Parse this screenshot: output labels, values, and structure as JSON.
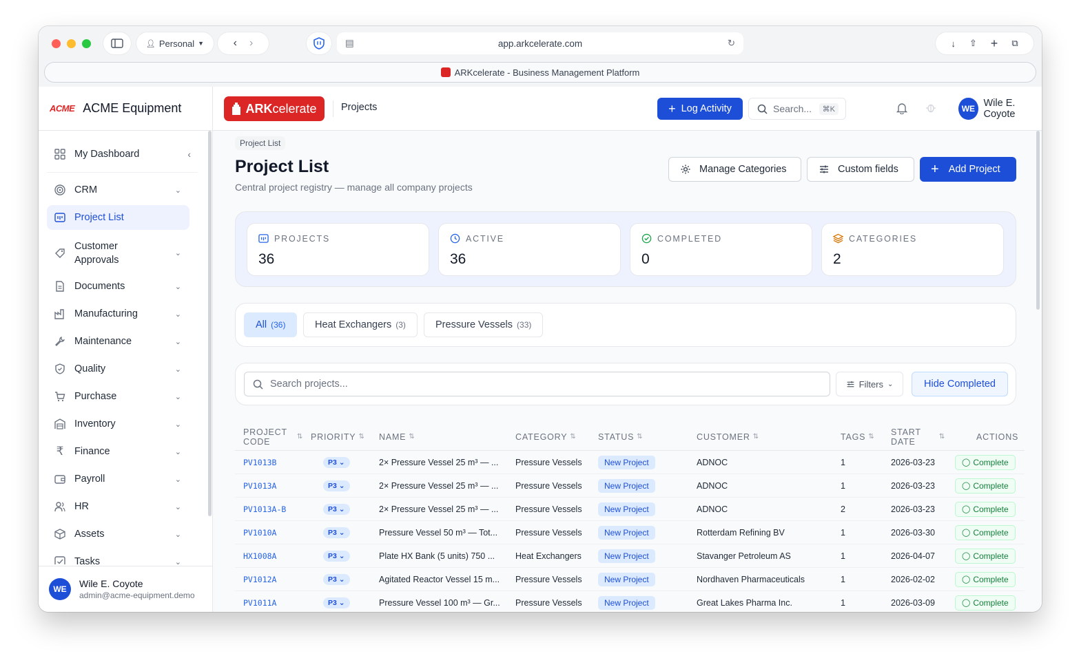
{
  "browser": {
    "profile": "Personal",
    "url": "app.arkcelerate.com",
    "tab_title": "ARKcelerate - Business Management Platform"
  },
  "sidebar": {
    "org_logo": "ACME",
    "org_name": "ACME Equipment",
    "items": [
      {
        "label": "My Dashboard",
        "icon": "dashboard-icon"
      },
      {
        "label": "CRM",
        "icon": "target-icon"
      },
      {
        "label": "Project List",
        "icon": "project-icon"
      },
      {
        "label": "Customer Approvals",
        "icon": "tag-icon"
      },
      {
        "label": "Documents",
        "icon": "document-icon"
      },
      {
        "label": "Manufacturing",
        "icon": "factory-icon"
      },
      {
        "label": "Maintenance",
        "icon": "wrench-icon"
      },
      {
        "label": "Quality",
        "icon": "shield-icon"
      },
      {
        "label": "Purchase",
        "icon": "cart-icon"
      },
      {
        "label": "Inventory",
        "icon": "warehouse-icon"
      },
      {
        "label": "Finance",
        "icon": "rupee-icon"
      },
      {
        "label": "Payroll",
        "icon": "wallet-icon"
      },
      {
        "label": "HR",
        "icon": "users-icon"
      },
      {
        "label": "Assets",
        "icon": "box-icon"
      },
      {
        "label": "Tasks",
        "icon": "checkbox-icon"
      }
    ],
    "user": {
      "initials": "WE",
      "name": "Wile E. Coyote",
      "email": "admin@acme-equipment.demo"
    }
  },
  "topbar": {
    "brand_bold": "ARK",
    "brand_light": "celerate",
    "title": "Projects",
    "log_activity": "Log Activity",
    "search_placeholder": "Search...",
    "search_kbd": "⌘K",
    "user_initials": "WE",
    "user_name": "Wile E. Coyote"
  },
  "page": {
    "breadcrumb": "Project List",
    "title": "Project List",
    "subtitle": "Central project registry — manage all company projects",
    "manage_categories": "Manage Categories",
    "custom_fields": "Custom fields",
    "add_project": "Add Project"
  },
  "stats": [
    {
      "label": "PROJECTS",
      "value": "36"
    },
    {
      "label": "ACTIVE",
      "value": "36"
    },
    {
      "label": "COMPLETED",
      "value": "0"
    },
    {
      "label": "CATEGORIES",
      "value": "2"
    }
  ],
  "category_tabs": [
    {
      "label": "All",
      "count": "(36)"
    },
    {
      "label": "Heat Exchangers",
      "count": "(3)"
    },
    {
      "label": "Pressure Vessels",
      "count": "(33)"
    }
  ],
  "filters": {
    "search_placeholder": "Search projects...",
    "filters_label": "Filters",
    "hide_completed": "Hide Completed"
  },
  "table": {
    "headers": {
      "code1": "PROJECT",
      "code2": "CODE",
      "priority": "PRIORITY",
      "name": "NAME",
      "category": "CATEGORY",
      "status": "STATUS",
      "customer": "CUSTOMER",
      "tags": "TAGS",
      "start1": "START",
      "start2": "DATE",
      "actions": "ACTIONS"
    },
    "rows": [
      {
        "code": "PV1013B",
        "priority": "P3",
        "name": "2× Pressure Vessel 25 m³ — ...",
        "category": "Pressure Vessels",
        "status": "New Project",
        "customer": "ADNOC",
        "tags": "1",
        "start": "2026-03-23",
        "action": "Complete"
      },
      {
        "code": "PV1013A",
        "priority": "P3",
        "name": "2× Pressure Vessel 25 m³ — ...",
        "category": "Pressure Vessels",
        "status": "New Project",
        "customer": "ADNOC",
        "tags": "1",
        "start": "2026-03-23",
        "action": "Complete"
      },
      {
        "code": "PV1013A-B",
        "priority": "P3",
        "name": "2× Pressure Vessel 25 m³ — ...",
        "category": "Pressure Vessels",
        "status": "New Project",
        "customer": "ADNOC",
        "tags": "2",
        "start": "2026-03-23",
        "action": "Complete"
      },
      {
        "code": "PV1010A",
        "priority": "P3",
        "name": "Pressure Vessel 50 m³ — Tot...",
        "category": "Pressure Vessels",
        "status": "New Project",
        "customer": "Rotterdam Refining BV",
        "tags": "1",
        "start": "2026-03-30",
        "action": "Complete"
      },
      {
        "code": "HX1008A",
        "priority": "P3",
        "name": "Plate HX Bank (5 units) 750 ...",
        "category": "Heat Exchangers",
        "status": "New Project",
        "customer": "Stavanger Petroleum AS",
        "tags": "1",
        "start": "2026-04-07",
        "action": "Complete"
      },
      {
        "code": "PV1012A",
        "priority": "P3",
        "name": "Agitated Reactor Vessel 15 m...",
        "category": "Pressure Vessels",
        "status": "New Project",
        "customer": "Nordhaven Pharmaceuticals",
        "tags": "1",
        "start": "2026-02-02",
        "action": "Complete"
      },
      {
        "code": "PV1011A",
        "priority": "P3",
        "name": "Pressure Vessel 100 m³ — Gr...",
        "category": "Pressure Vessels",
        "status": "New Project",
        "customer": "Great Lakes Pharma Inc.",
        "tags": "1",
        "start": "2026-03-09",
        "action": "Complete"
      }
    ]
  },
  "colors": {
    "primary": "#1d4ed8",
    "brand_red": "#dc2626",
    "success": "#15803d"
  }
}
